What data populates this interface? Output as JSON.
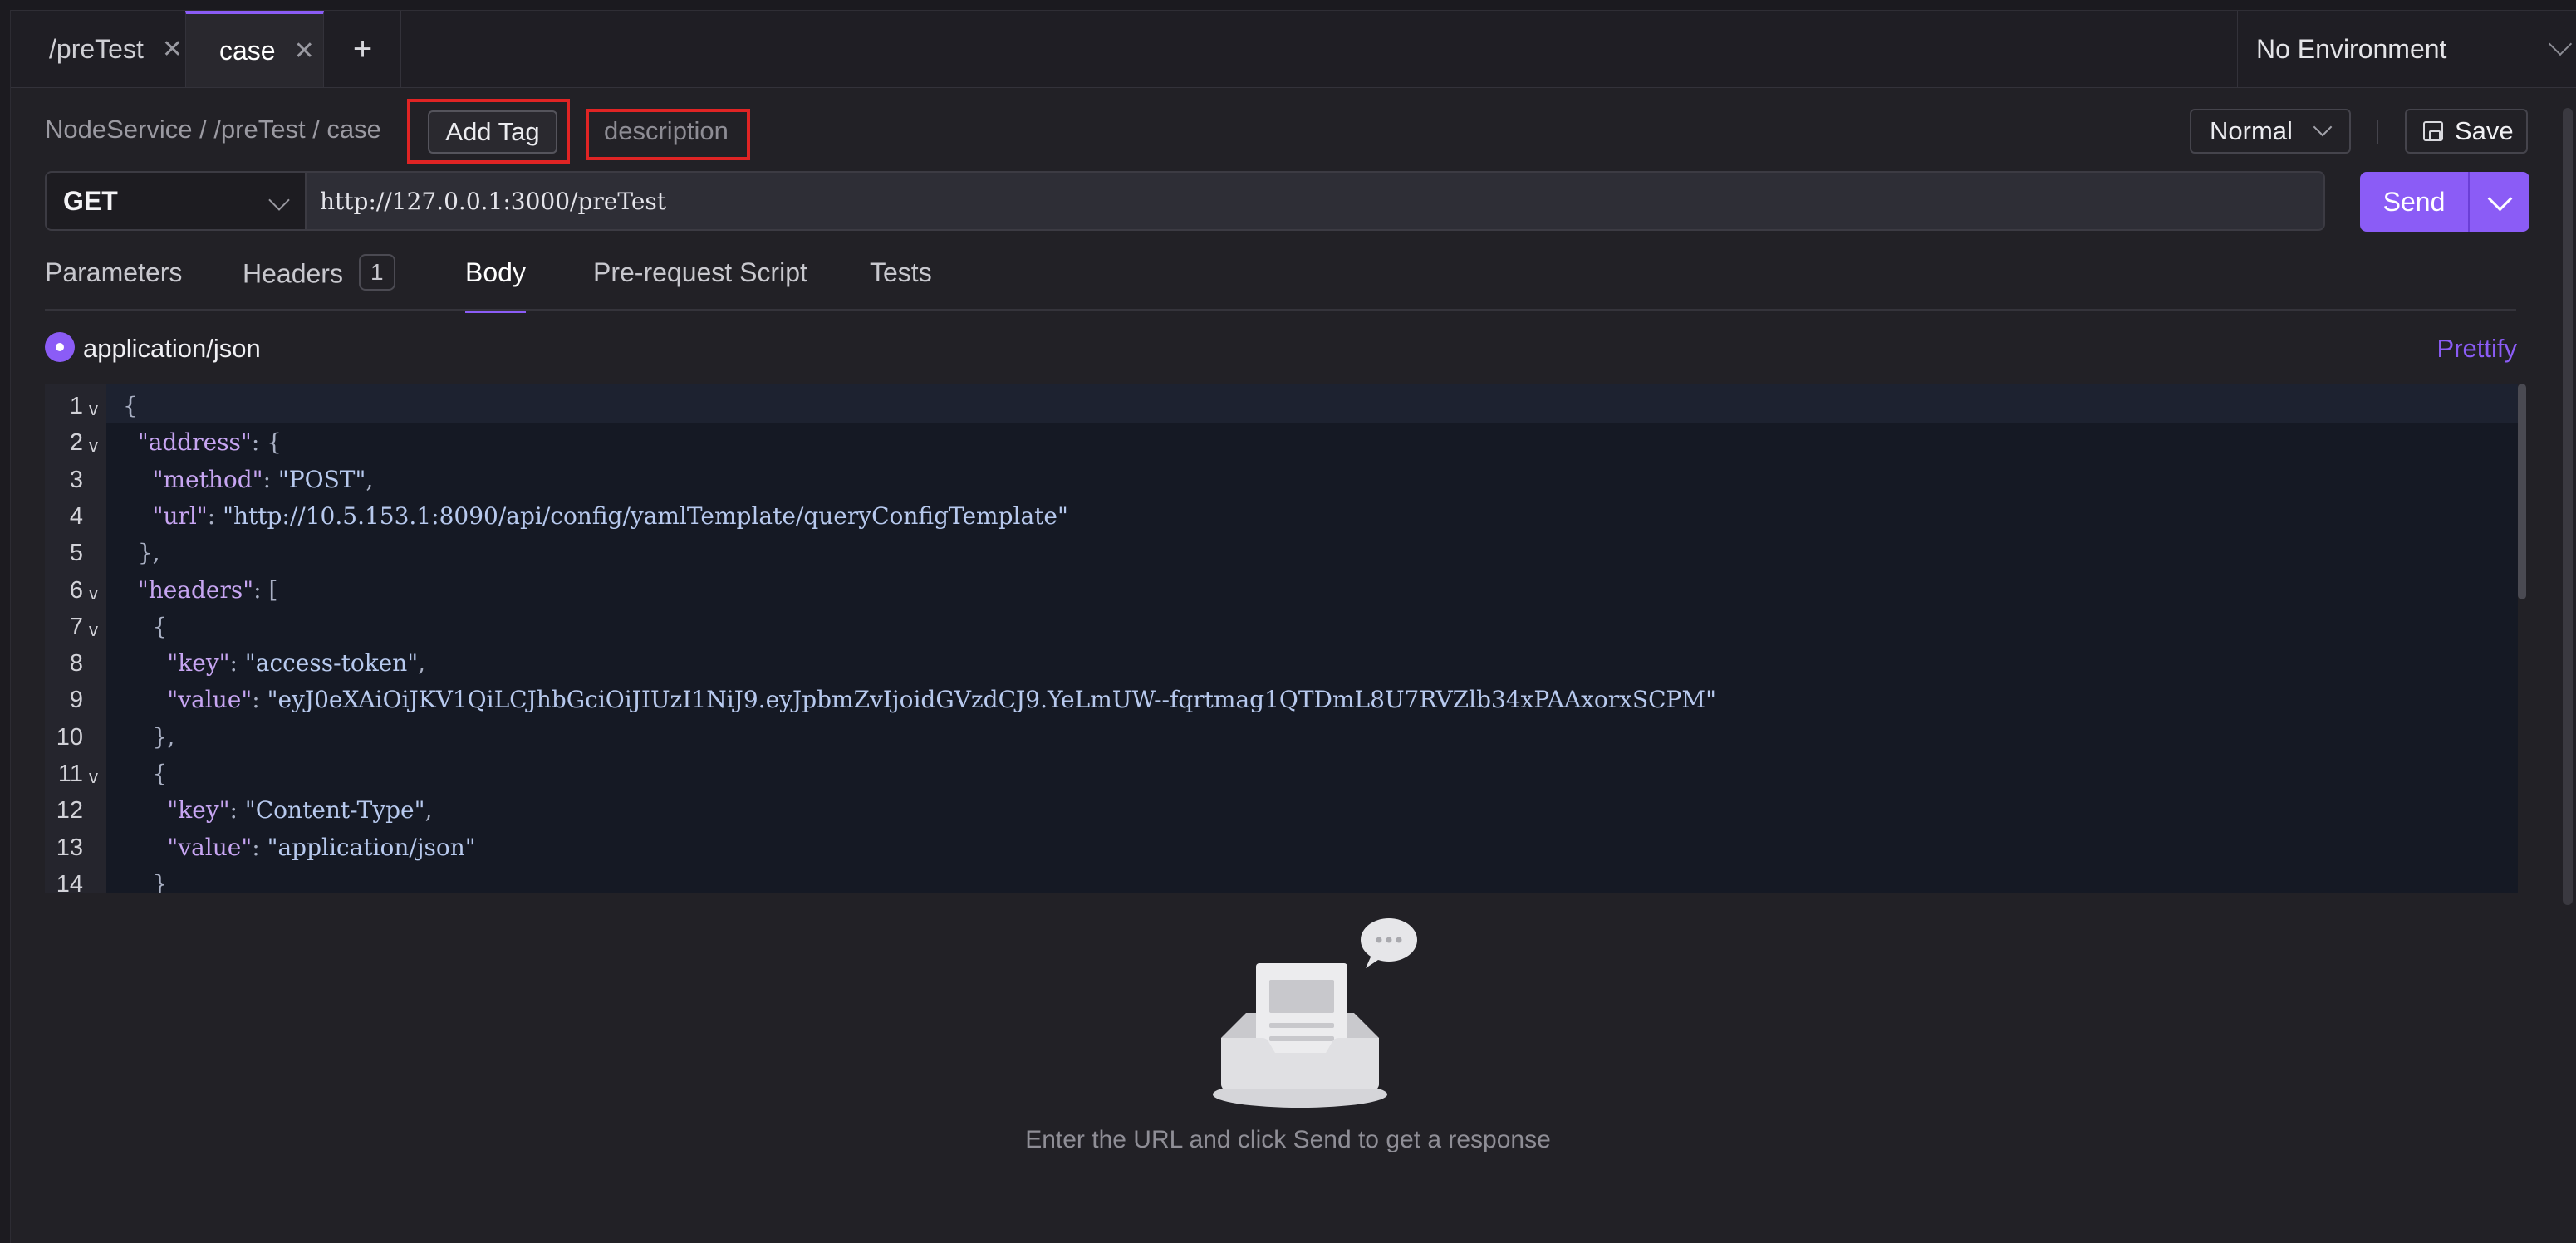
{
  "tabs": [
    {
      "label": "/preTest",
      "active": false
    },
    {
      "label": "case",
      "active": true
    }
  ],
  "new_tab_label": "+",
  "environment": {
    "selected": "No Environment"
  },
  "breadcrumb": "NodeService / /preTest / case",
  "add_tag_label": "Add Tag",
  "description_placeholder": "description",
  "mode": {
    "selected": "Normal"
  },
  "save_label": "Save",
  "request": {
    "method": "GET",
    "url": "http://127.0.0.1:3000/preTest",
    "send_label": "Send"
  },
  "request_tabs": [
    {
      "label": "Parameters"
    },
    {
      "label": "Headers",
      "badge": "1"
    },
    {
      "label": "Body",
      "active": true
    },
    {
      "label": "Pre-request Script"
    },
    {
      "label": "Tests"
    }
  ],
  "body": {
    "content_type": "application/json",
    "prettify_label": "Prettify",
    "line_numbers": [
      "1",
      "2",
      "3",
      "4",
      "5",
      "6",
      "7",
      "8",
      "9",
      "10",
      "11",
      "12",
      "13",
      "14"
    ],
    "lines": [
      {
        "indent": "",
        "key": "",
        "value": "",
        "text": "{"
      },
      {
        "indent": "  ",
        "key": "\"address\"",
        "value": "",
        "text": ": {"
      },
      {
        "indent": "    ",
        "key": "\"method\"",
        "value": "\"POST\"",
        "text": ","
      },
      {
        "indent": "    ",
        "key": "\"url\"",
        "value": "\"http://10.5.153.1:8090/api/config/yamlTemplate/queryConfigTemplate\"",
        "text": ""
      },
      {
        "indent": "  ",
        "key": "",
        "value": "",
        "text": "},"
      },
      {
        "indent": "  ",
        "key": "\"headers\"",
        "value": "",
        "text": ": ["
      },
      {
        "indent": "    ",
        "key": "",
        "value": "",
        "text": "{"
      },
      {
        "indent": "      ",
        "key": "\"key\"",
        "value": "\"access-token\"",
        "text": ","
      },
      {
        "indent": "      ",
        "key": "\"value\"",
        "value": "\"eyJ0eXAiOiJKV1QiLCJhbGciOiJIUzI1NiJ9.eyJpbmZvIjoidGVzdCJ9.YeLmUW--fqrtmag1QTDmL8U7RVZlb34xPAAxorxSCPM\"",
        "text": ""
      },
      {
        "indent": "    ",
        "key": "",
        "value": "",
        "text": "},"
      },
      {
        "indent": "    ",
        "key": "",
        "value": "",
        "text": "{"
      },
      {
        "indent": "      ",
        "key": "\"key\"",
        "value": "\"Content-Type\"",
        "text": ","
      },
      {
        "indent": "      ",
        "key": "\"value\"",
        "value": "\"application/json\"",
        "text": ""
      },
      {
        "indent": "    ",
        "key": "",
        "value": "",
        "text": "}"
      }
    ],
    "folded_lines": [
      "1",
      "2",
      "6",
      "7",
      "11"
    ]
  },
  "response": {
    "empty_message": "Enter the URL and click Send to get a response"
  },
  "colors": {
    "accent": "#8b5cf6",
    "highlight_border": "#e02424",
    "background": "#222126",
    "editor_background": "#151924"
  }
}
